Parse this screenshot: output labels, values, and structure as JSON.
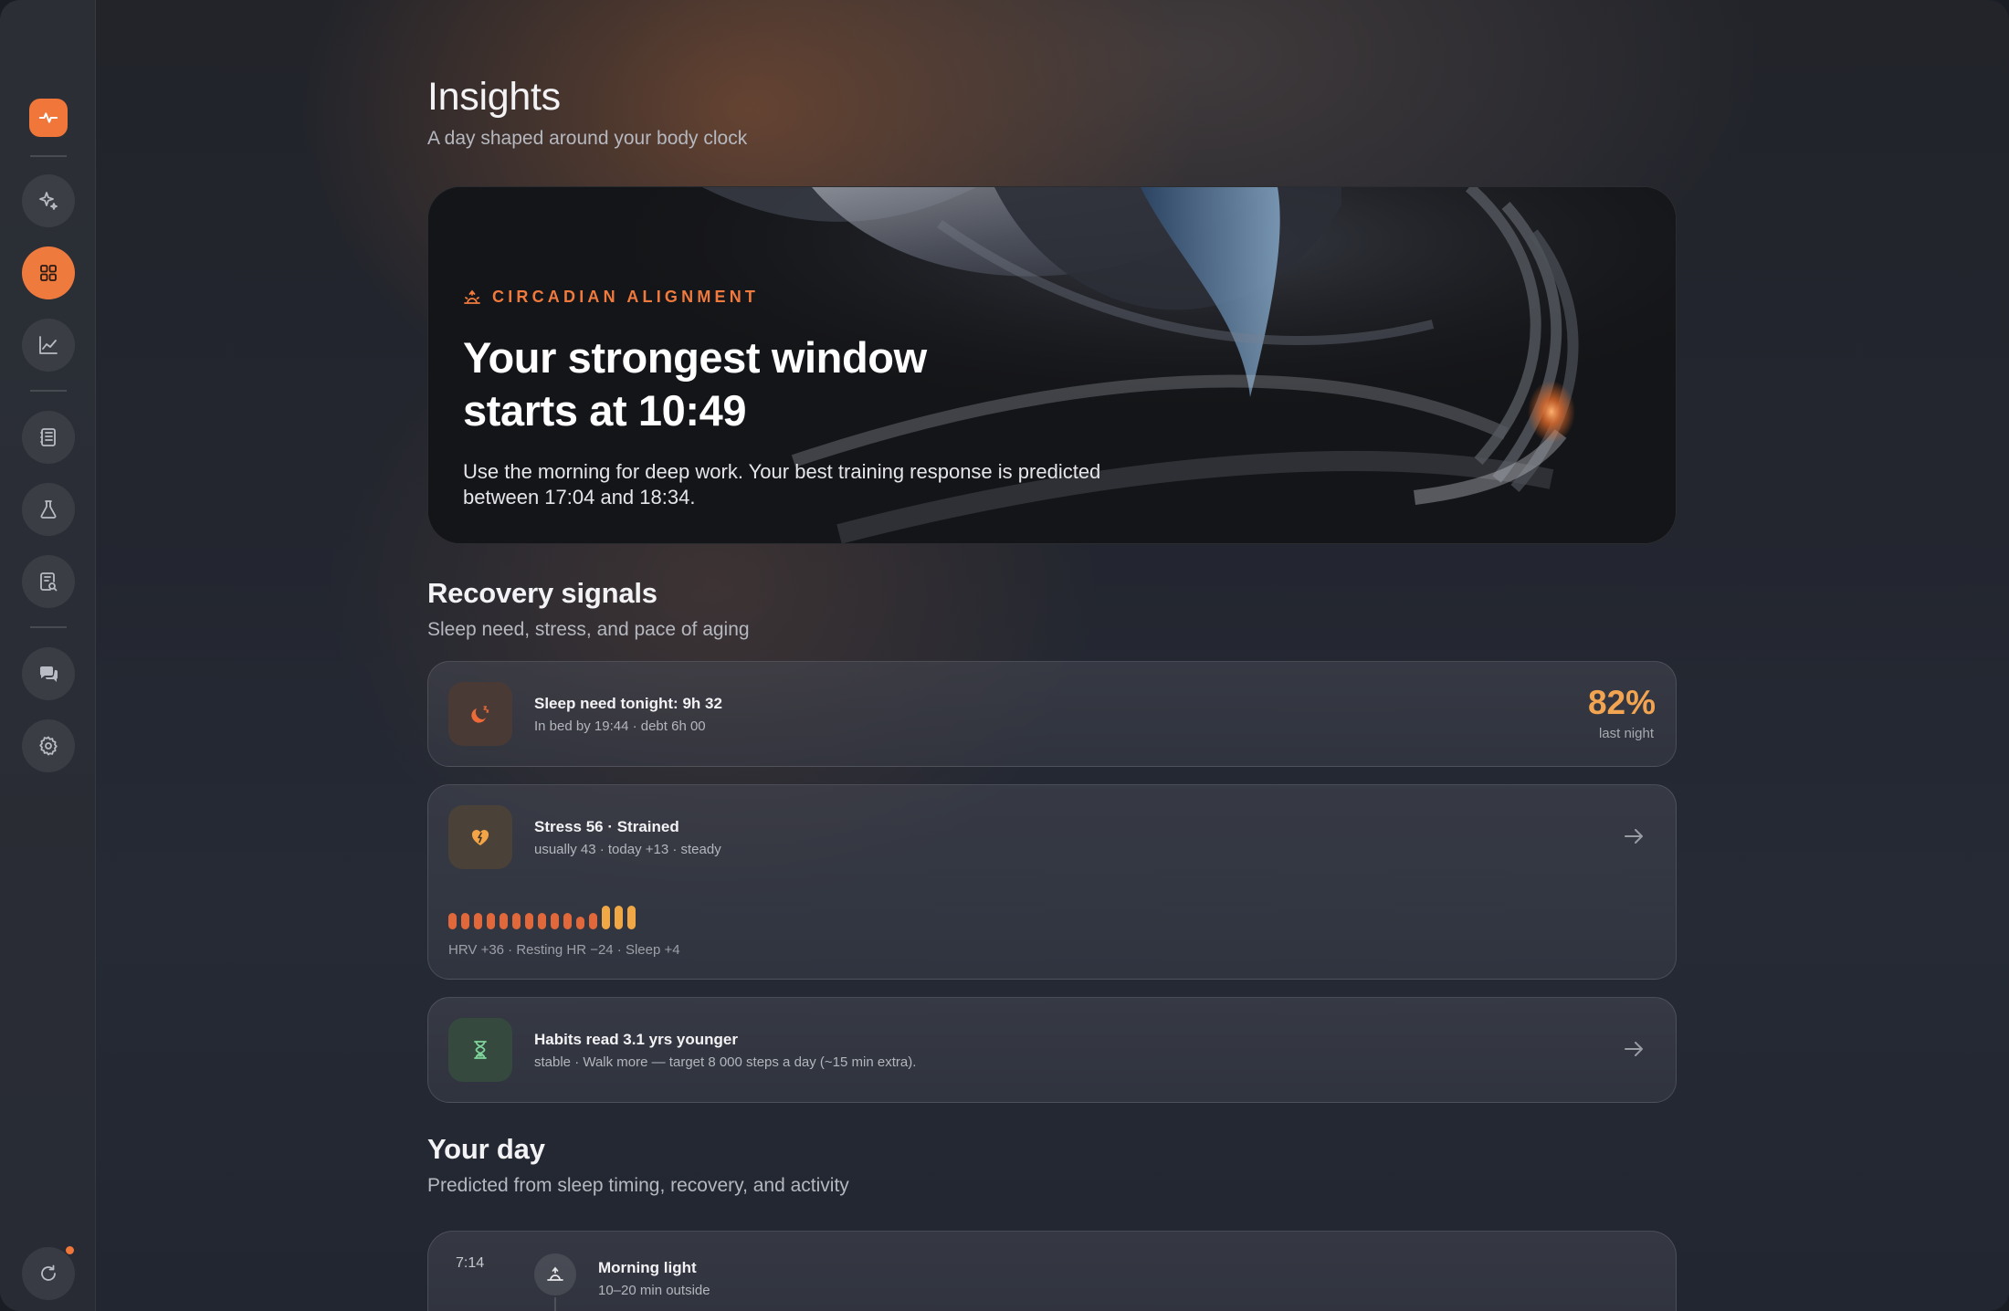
{
  "window": {
    "controls": [
      "close",
      "minimize",
      "zoom"
    ]
  },
  "sidebar": {
    "logo_icon": "pulse-icon",
    "items": [
      {
        "name": "sparkle",
        "icon": "sparkle-icon",
        "active": false
      },
      {
        "name": "dashboard",
        "icon": "grid-icon",
        "active": true
      },
      {
        "name": "trends",
        "icon": "chart-icon",
        "active": false
      },
      {
        "name": "journal",
        "icon": "notebook-icon",
        "active": false
      },
      {
        "name": "lab",
        "icon": "flask-icon",
        "active": false
      },
      {
        "name": "reports",
        "icon": "report-search-icon",
        "active": false
      },
      {
        "name": "chat",
        "icon": "chat-icon",
        "active": false
      },
      {
        "name": "settings",
        "icon": "gear-icon",
        "active": false
      },
      {
        "name": "sync",
        "icon": "refresh-icon",
        "active": false
      }
    ]
  },
  "header": {
    "title": "Insights",
    "subtitle": "A day shaped around your body clock"
  },
  "hero": {
    "tag": "CIRCADIAN ALIGNMENT",
    "title_line1": "Your strongest window",
    "title_line2": "starts at 10:49",
    "body": "Use the morning for deep work. Your best training response is predicted between 17:04 and 18:34."
  },
  "recovery": {
    "title": "Recovery signals",
    "subtitle": "Sleep need, stress, and pace of aging",
    "sleep": {
      "title": "Sleep need tonight: 9h 32",
      "meta": "In bed by 19:44 · debt 6h 00",
      "percent": "82%",
      "percent_label": "last night"
    },
    "stress": {
      "title": "Stress 56 · Strained",
      "meta": "usually 43 · today +13 · steady",
      "bars": [
        {
          "level": 0.6,
          "tone": "warm"
        },
        {
          "level": 0.6,
          "tone": "warm"
        },
        {
          "level": 0.6,
          "tone": "warm"
        },
        {
          "level": 0.6,
          "tone": "warm"
        },
        {
          "level": 0.6,
          "tone": "warm"
        },
        {
          "level": 0.6,
          "tone": "warm"
        },
        {
          "level": 0.6,
          "tone": "warm"
        },
        {
          "level": 0.6,
          "tone": "warm"
        },
        {
          "level": 0.6,
          "tone": "warm"
        },
        {
          "level": 0.6,
          "tone": "warm"
        },
        {
          "level": 0.45,
          "tone": "warm"
        },
        {
          "level": 0.6,
          "tone": "warm"
        },
        {
          "level": 0.85,
          "tone": "amber"
        },
        {
          "level": 0.85,
          "tone": "amber"
        },
        {
          "level": 0.85,
          "tone": "amber"
        }
      ],
      "footer": "HRV +36 · Resting HR −24 · Sleep +4"
    },
    "aging": {
      "title": "Habits read 3.1 yrs younger",
      "meta": "stable · Walk more — target 8 000 steps a day (~15 min extra)."
    }
  },
  "day": {
    "title": "Your day",
    "subtitle": "Predicted from sleep timing, recovery, and activity",
    "items": [
      {
        "time": "7:14",
        "title": "Morning light",
        "meta": "10–20 min outside",
        "icon": "sunrise-icon"
      }
    ]
  },
  "colors": {
    "accent": "#f0763a",
    "accent_text": "#f2a451",
    "bar_warm": "#e0683a",
    "bar_amber": "#f0a847"
  }
}
